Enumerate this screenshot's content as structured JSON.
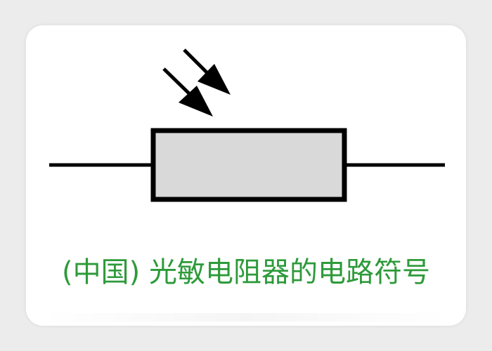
{
  "caption": "(中国) 光敏电阻器的电路符号",
  "colors": {
    "caption": "#2d9a3a",
    "resistor_fill": "#d9d9d9",
    "stroke": "#000000",
    "background": "#ffffff"
  },
  "symbol": {
    "component": "photoresistor",
    "light_arrows": 2
  }
}
